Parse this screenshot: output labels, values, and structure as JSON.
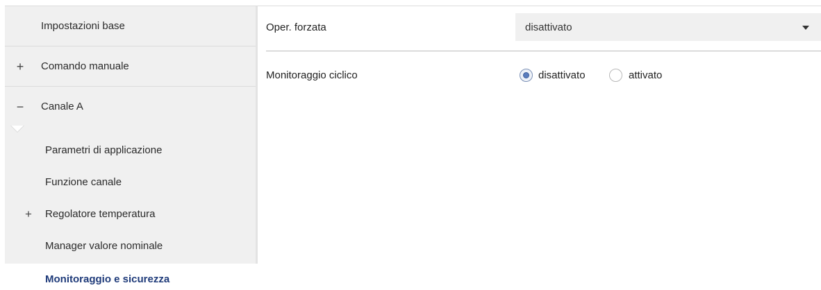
{
  "sidebar": {
    "groups": [
      {
        "sign": "",
        "label": "Impostazioni base"
      },
      {
        "sign": "+",
        "label": "Comando manuale"
      },
      {
        "sign": "−",
        "label": "Canale A"
      }
    ],
    "sub_items": [
      {
        "sign": "",
        "label": "Parametri di applicazione"
      },
      {
        "sign": "",
        "label": "Funzione canale"
      },
      {
        "sign": "+",
        "label": "Regolatore temperatura"
      },
      {
        "sign": "",
        "label": "Manager valore nominale"
      },
      {
        "sign": "",
        "label": "Monitoraggio e sicurezza",
        "active": true
      }
    ]
  },
  "main": {
    "forced_operation": {
      "label": "Oper. forzata",
      "selected": "disattivato"
    },
    "cyclic_monitoring": {
      "label": "Monitoraggio ciclico",
      "options": [
        "disattivato",
        "attivato"
      ],
      "selected": "disattivato"
    }
  },
  "colors": {
    "active_text": "#1f3b7a",
    "sidebar_bg": "#f0f0f0",
    "radio_checked": "#5b7dbd"
  }
}
